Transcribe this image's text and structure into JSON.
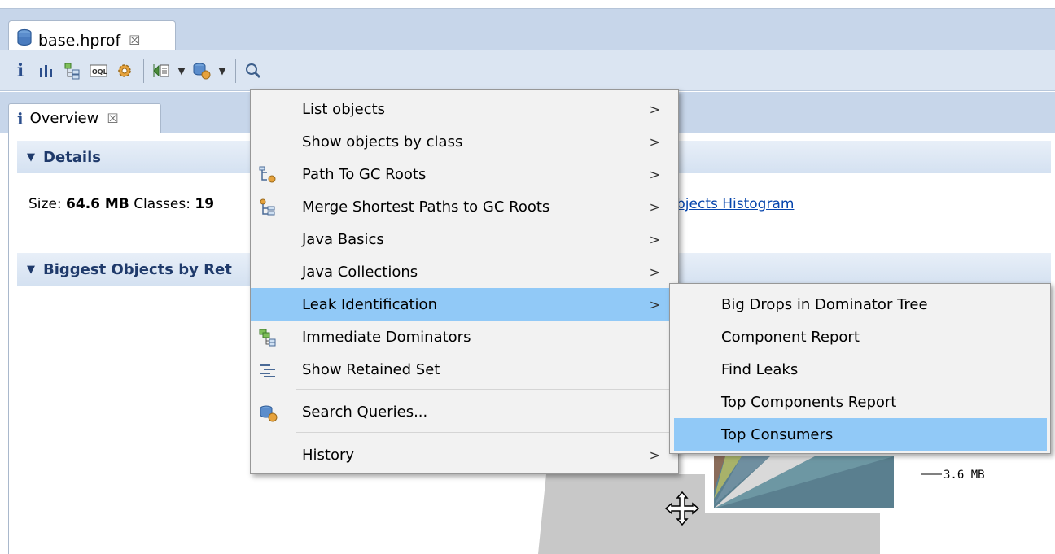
{
  "editor_tab": {
    "label": "base.hprof",
    "close": "☒"
  },
  "view_tab": {
    "icon_text": "i",
    "label": "Overview",
    "close": "☒"
  },
  "sections": {
    "details": "Details",
    "biggest": "Biggest Objects by Ret"
  },
  "details_line": {
    "size_label": "Size:",
    "size_value": "64.6 MB",
    "classes_label": "Classes:",
    "classes_value": "19"
  },
  "histogram_link": "bjects Histogram",
  "chart_annotation": "3.6 MB",
  "context_menu": {
    "items": [
      {
        "label": "List objects",
        "arrow": ">"
      },
      {
        "label": "Show objects by class",
        "arrow": ">"
      },
      {
        "label": "Path To GC Roots",
        "arrow": ">"
      },
      {
        "label": "Merge Shortest Paths to GC Roots",
        "arrow": ">"
      },
      {
        "label": "Java Basics",
        "arrow": ">"
      },
      {
        "label": "Java Collections",
        "arrow": ">"
      },
      {
        "label": "Leak Identification",
        "arrow": ">"
      },
      {
        "label": "Immediate Dominators",
        "arrow": ""
      },
      {
        "label": "Show Retained Set",
        "arrow": ""
      },
      {
        "label": "Search Queries...",
        "arrow": ""
      },
      {
        "label": "History",
        "arrow": ">"
      }
    ]
  },
  "submenu": {
    "items": [
      {
        "label": "Big Drops in Dominator Tree"
      },
      {
        "label": "Component Report"
      },
      {
        "label": "Find Leaks"
      },
      {
        "label": "Top Components Report"
      },
      {
        "label": "Top Consumers"
      }
    ]
  },
  "colors": {
    "highlight": "#91c9f7",
    "link": "#0645ad",
    "section_title": "#1f3a6b"
  }
}
